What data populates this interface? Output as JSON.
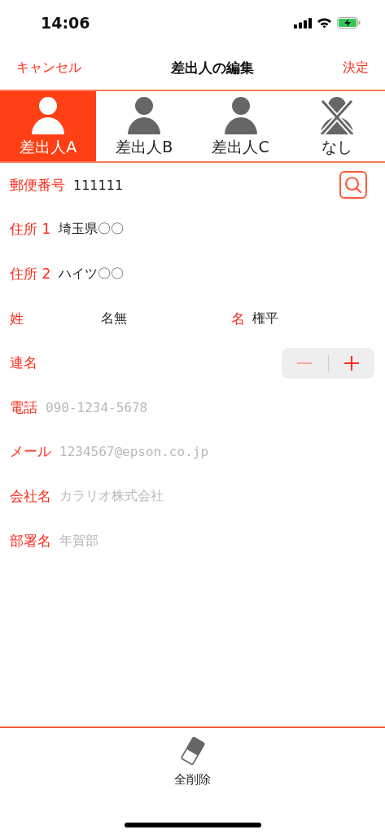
{
  "status_bar": {
    "time": "14:06"
  },
  "nav": {
    "cancel": "キャンセル",
    "title": "差出人の編集",
    "done": "決定"
  },
  "tabs": [
    {
      "label": "差出人A",
      "kind": "person",
      "selected": true
    },
    {
      "label": "差出人B",
      "kind": "person",
      "selected": false
    },
    {
      "label": "差出人C",
      "kind": "person",
      "selected": false
    },
    {
      "label": "なし",
      "kind": "none",
      "selected": false
    }
  ],
  "fields": [
    {
      "kind": "zip",
      "label": "郵便番号",
      "value": "111111"
    },
    {
      "kind": "text",
      "label": "住所 1",
      "value": "埼玉県〇〇"
    },
    {
      "kind": "text",
      "label": "住所 2",
      "value": "ハイツ〇〇"
    },
    {
      "kind": "name",
      "last_label": "姓",
      "last_value": "名無",
      "first_label": "名",
      "first_value": "権平"
    },
    {
      "kind": "stepper",
      "label": "連名",
      "minus_disabled": true
    },
    {
      "kind": "text",
      "label": "電話",
      "placeholder": "090-1234-5678"
    },
    {
      "kind": "text",
      "label": "メール",
      "placeholder": "1234567@epson.co.jp"
    },
    {
      "kind": "text",
      "label": "会社名",
      "placeholder": "カラリオ株式会社"
    },
    {
      "kind": "text",
      "label": "部署名",
      "placeholder": "年賀部"
    }
  ],
  "footer": {
    "clear_label": "全削除"
  }
}
